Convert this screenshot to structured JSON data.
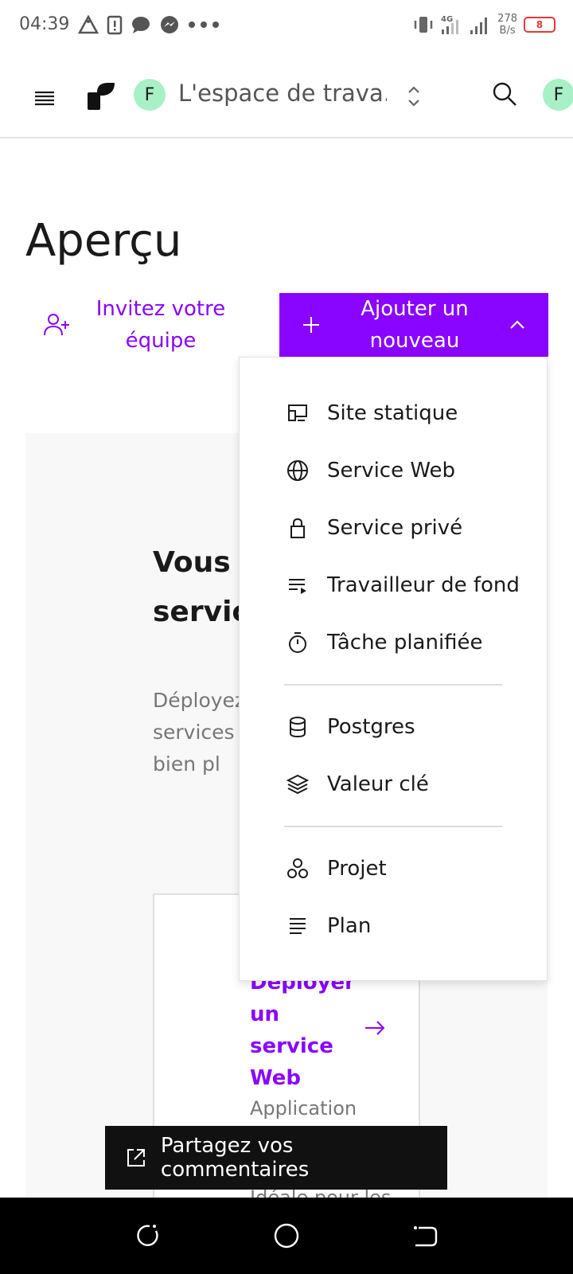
{
  "status_bar": {
    "time": "04:39",
    "speed_value": "278",
    "speed_unit": "B/s",
    "battery_level": "8",
    "network": "4G",
    "icons": [
      "alert-triangle-icon",
      "battery-alert-icon",
      "chat-icon",
      "messenger-icon",
      "more-dots-icon",
      "vibrate-icon",
      "signal-4g-icon",
      "signal-icon"
    ]
  },
  "topnav": {
    "workspace_initial": "F",
    "workspace_name": "L'espace de trava...",
    "user_initial": "F"
  },
  "page": {
    "title": "Aperçu",
    "invite_label": "Invitez votre équipe",
    "add_new_label": "Ajouter un nouveau"
  },
  "dropdown": {
    "items": [
      {
        "label": "Site statique",
        "icon": "static-site-icon"
      },
      {
        "label": "Service Web",
        "icon": "globe-icon"
      },
      {
        "label": "Service privé",
        "icon": "lock-icon"
      },
      {
        "label": "Travailleur de fond",
        "icon": "background-worker-icon"
      },
      {
        "label": "Tâche planifiée",
        "icon": "timer-icon"
      },
      {
        "label": "Postgres",
        "icon": "database-icon"
      },
      {
        "label": "Valeur clé",
        "icon": "layers-icon"
      },
      {
        "label": "Projet",
        "icon": "project-icon"
      },
      {
        "label": "Plan",
        "icon": "blueprint-icon"
      }
    ]
  },
  "empty_state": {
    "heading": "Vous n encore servic",
    "description": "Déployez minutes. services statiques et bien pl"
  },
  "deploy_card": {
    "title": "Déployer un service Web",
    "desc_top": "Application",
    "desc_bottom": "Idéale pour les"
  },
  "feedback": {
    "label": "Partagez vos commentaires"
  },
  "colors": {
    "accent": "#8a05ff",
    "avatar_bg": "#a8f0c6"
  }
}
